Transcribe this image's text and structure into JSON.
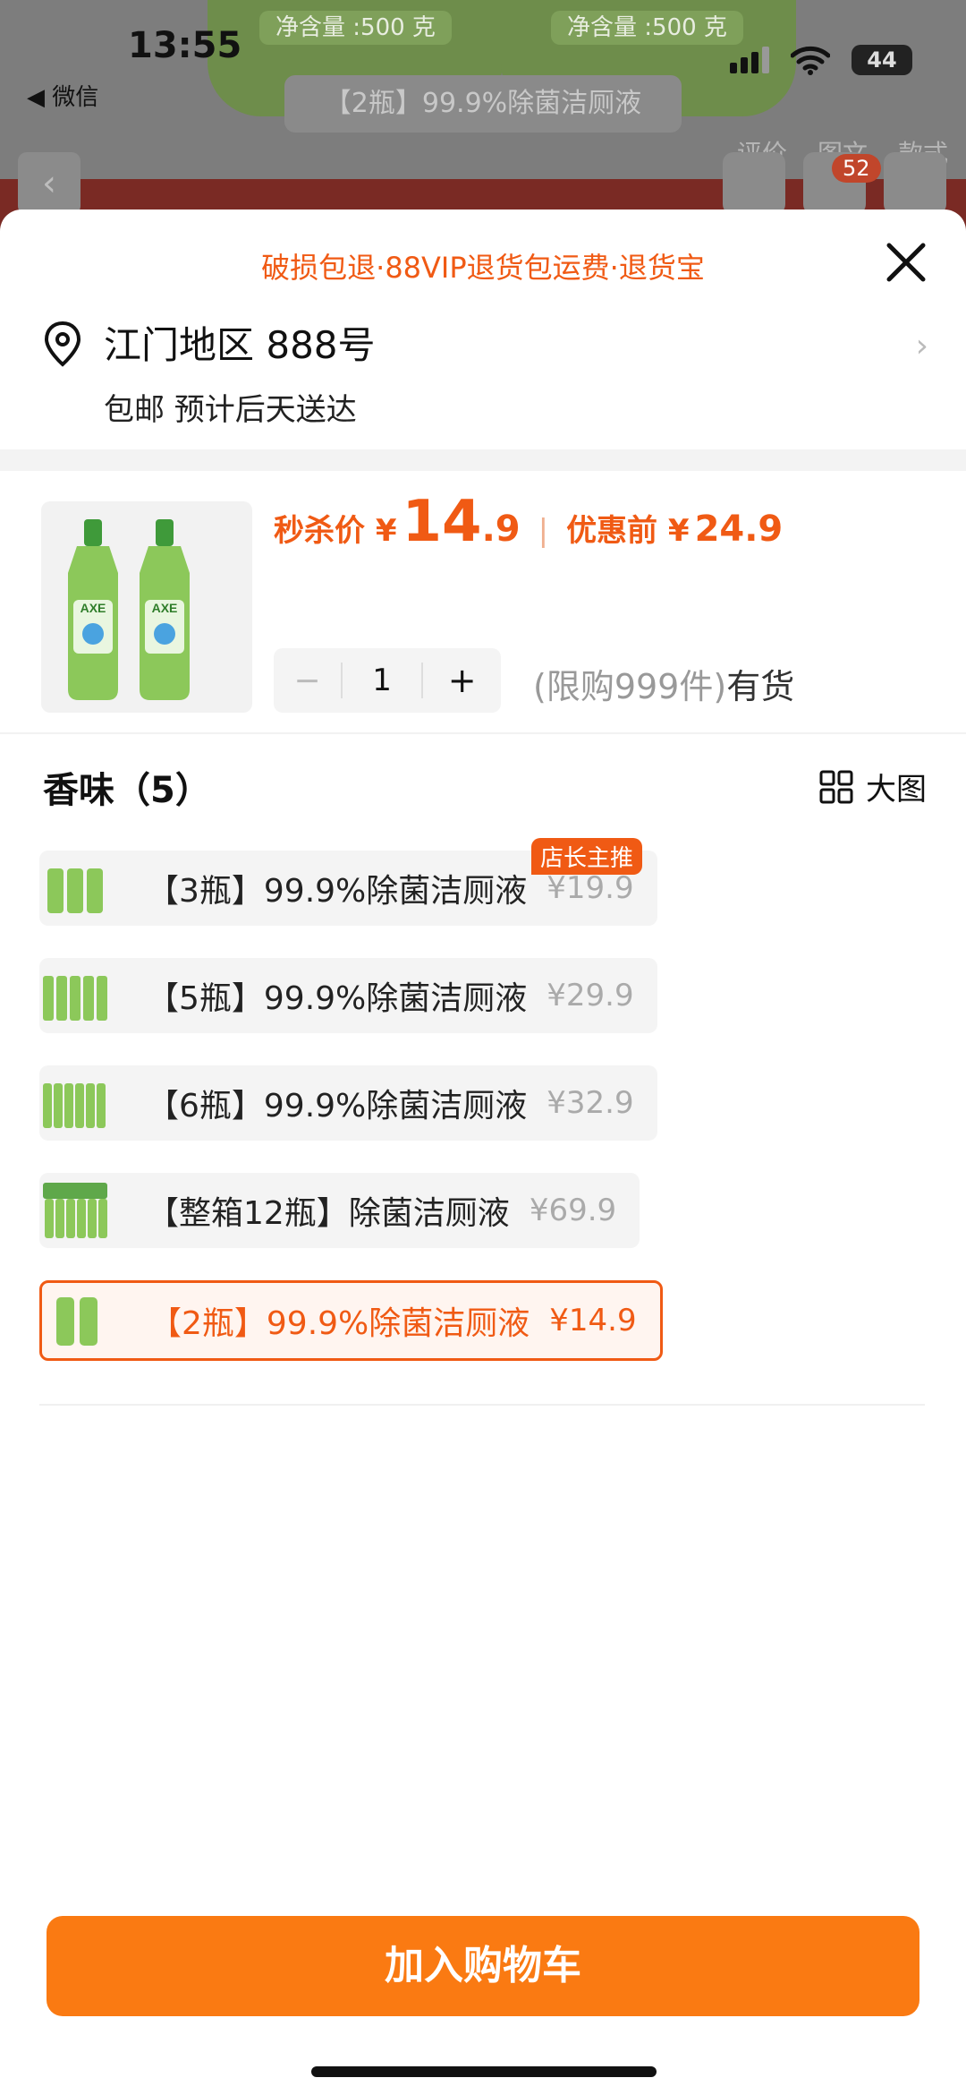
{
  "status_bar": {
    "time": "13:55",
    "back_app": "◀ 微信",
    "battery": "44"
  },
  "background_page": {
    "net_content_left": "净含量 :500 克",
    "net_content_right": "净含量 :500 克",
    "product_title": "【2瓶】99.9%除菌洁厕液",
    "cart_count": "52",
    "tabs": [
      "评价",
      "图文",
      "款式"
    ]
  },
  "sheet": {
    "promo": "破损包退·88VIP退货包运费·退货宝",
    "address": "江门地区 888号",
    "shipping": "包邮 预计后天送达",
    "price": {
      "label": "秒杀价 ¥",
      "integer": "14",
      "decimal": ".9",
      "pre_label": "优惠前 ¥",
      "pre_value": "24.9"
    },
    "quantity": {
      "minus": "−",
      "value": "1",
      "plus": "+"
    },
    "stock": {
      "limit": "(限购999件)",
      "status": "有货"
    },
    "section_title": "香味（5）",
    "big_view_label": "大图",
    "options": [
      {
        "label": "【3瓶】99.9%除菌洁厕液",
        "price": "¥19.9",
        "badge": "店长主推"
      },
      {
        "label": "【5瓶】99.9%除菌洁厕液",
        "price": "¥29.9"
      },
      {
        "label": "【6瓶】99.9%除菌洁厕液",
        "price": "¥32.9"
      },
      {
        "label": "【整箱12瓶】除菌洁厕液",
        "price": "¥69.9"
      },
      {
        "label": "【2瓶】99.9%除菌洁厕液",
        "price": "¥14.9",
        "selected": true
      }
    ],
    "add_to_cart": "加入购物车"
  },
  "colors": {
    "accent": "#f05a14",
    "button": "#fa7a12",
    "bottle_green": "#7dbf52"
  }
}
